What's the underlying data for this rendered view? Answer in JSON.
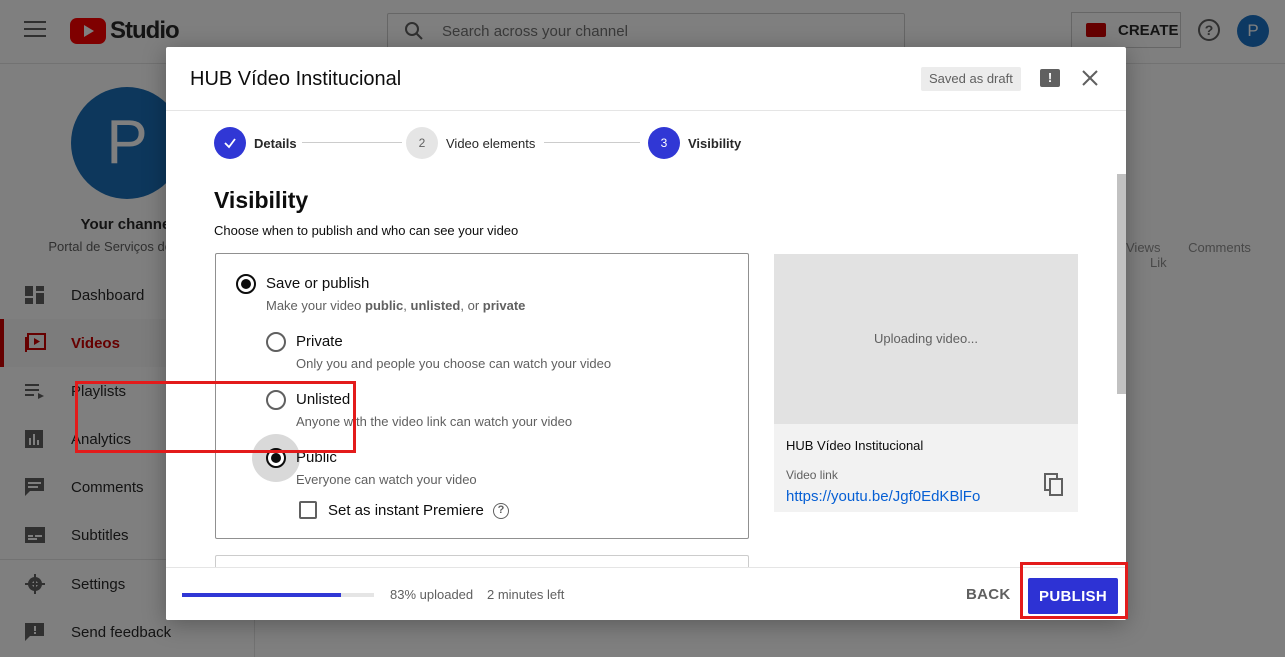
{
  "app": {
    "logo_text": "Studio",
    "search_placeholder": "Search across your channel",
    "create_label": "CREATE",
    "help_glyph": "?",
    "user_initial": "P"
  },
  "sidebar": {
    "channel_initial": "P",
    "channel_title": "Your channel",
    "channel_subtitle": "Portal de Serviços do Gove",
    "items": [
      {
        "label": "Dashboard",
        "icon": "dashboard-icon"
      },
      {
        "label": "Videos",
        "icon": "videos-icon",
        "active": true
      },
      {
        "label": "Playlists",
        "icon": "playlists-icon"
      },
      {
        "label": "Analytics",
        "icon": "analytics-icon"
      },
      {
        "label": "Comments",
        "icon": "comments-icon"
      },
      {
        "label": "Subtitles",
        "icon": "subtitles-icon"
      }
    ],
    "bottom_items": [
      {
        "label": "Settings",
        "icon": "gear-icon"
      },
      {
        "label": "Send feedback",
        "icon": "feedback-icon"
      }
    ]
  },
  "content": {
    "col_views": "Views",
    "col_comments": "Comments",
    "col_likes": "Lik"
  },
  "dialog": {
    "title": "HUB Vídeo Institucional",
    "draft_status": "Saved as draft",
    "feedback_glyph": "!",
    "steps": [
      {
        "number": "",
        "label": "Details",
        "state": "done"
      },
      {
        "number": "2",
        "label": "Video elements",
        "state": "pending"
      },
      {
        "number": "3",
        "label": "Visibility",
        "state": "current"
      }
    ],
    "visibility": {
      "heading": "Visibility",
      "subheading": "Choose when to publish and who can see your video",
      "save_publish_label": "Save or publish",
      "save_publish_desc_prefix": "Make your video ",
      "save_publish_desc_public": "public",
      "save_publish_desc_sep1": ", ",
      "save_publish_desc_unlisted": "unlisted",
      "save_publish_desc_sep2": ", or ",
      "save_publish_desc_private": "private",
      "options": [
        {
          "label": "Private",
          "desc": "Only you and people you choose can watch your video",
          "selected": false
        },
        {
          "label": "Unlisted",
          "desc": "Anyone with the video link can watch your video",
          "selected": false
        },
        {
          "label": "Public",
          "desc": "Everyone can watch your video",
          "selected": true
        }
      ],
      "premiere_label": "Set as instant Premiere",
      "premiere_help_glyph": "?"
    },
    "preview": {
      "status": "Uploading video...",
      "video_title": "HUB Vídeo Institucional",
      "link_label": "Video link",
      "link_url": "https://youtu.be/Jgf0EdKBlFo"
    },
    "footer": {
      "progress_fraction": 0.83,
      "uploaded_text": "83% uploaded",
      "time_left": "2 minutes left",
      "back_label": "BACK",
      "publish_label": "PUBLISH"
    }
  },
  "colors": {
    "accent": "#2d32d4",
    "brand_red": "#ff0000",
    "link": "#065fd4",
    "annotation": "#e31b1b"
  }
}
